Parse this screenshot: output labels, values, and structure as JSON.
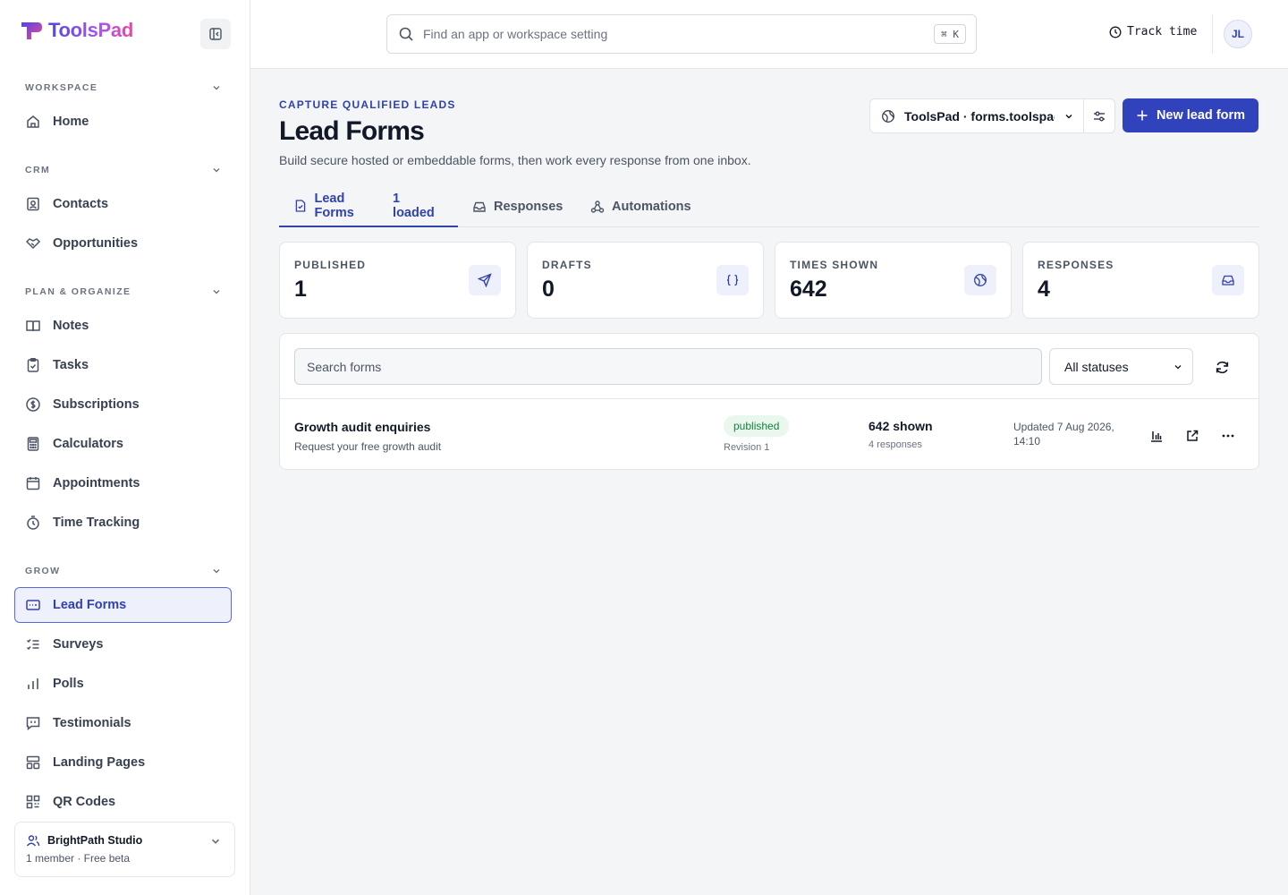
{
  "app": {
    "name": "ToolsPad"
  },
  "sidebar": {
    "sections": [
      {
        "label": "WORKSPACE"
      },
      {
        "label": "CRM"
      },
      {
        "label": "PLAN & ORGANIZE"
      },
      {
        "label": "GROW"
      }
    ],
    "items": [
      {
        "label": "Home",
        "icon": "home-icon"
      },
      {
        "label": "Contacts",
        "icon": "contact-icon"
      },
      {
        "label": "Opportunities",
        "icon": "handshake-icon"
      },
      {
        "label": "Notes",
        "icon": "notebook-icon"
      },
      {
        "label": "Tasks",
        "icon": "clipboard-check-icon"
      },
      {
        "label": "Subscriptions",
        "icon": "dollar-circle-icon"
      },
      {
        "label": "Calculators",
        "icon": "calculator-icon"
      },
      {
        "label": "Appointments",
        "icon": "calendar-icon"
      },
      {
        "label": "Time Tracking",
        "icon": "stopwatch-icon"
      },
      {
        "label": "Lead Forms",
        "icon": "form-icon",
        "active": true
      },
      {
        "label": "Surveys",
        "icon": "list-check-icon"
      },
      {
        "label": "Polls",
        "icon": "bar-chart-icon"
      },
      {
        "label": "Testimonials",
        "icon": "message-quote-icon"
      },
      {
        "label": "Landing Pages",
        "icon": "layout-icon"
      },
      {
        "label": "QR Codes",
        "icon": "qr-code-icon"
      }
    ],
    "workspace": {
      "name": "BrightPath Studio",
      "meta": "1 member · Free beta"
    }
  },
  "topbar": {
    "search_placeholder": "Find an app or workspace setting",
    "shortcut": "⌘ K",
    "track_time": "Track time",
    "avatar_initials": "JL"
  },
  "header": {
    "eyebrow": "CAPTURE QUALIFIED LEADS",
    "title": "Lead Forms",
    "subtitle": "Build secure hosted or embeddable forms, then work every response from one inbox.",
    "workspace_select": "ToolsPad · forms.toolspad",
    "new_button": "New lead form"
  },
  "tabs": [
    {
      "label": "Lead Forms",
      "count": "1 loaded",
      "active": true
    },
    {
      "label": "Responses"
    },
    {
      "label": "Automations"
    }
  ],
  "stats": [
    {
      "label": "PUBLISHED",
      "value": "1",
      "icon": "send-icon"
    },
    {
      "label": "DRAFTS",
      "value": "0",
      "icon": "braces-icon"
    },
    {
      "label": "TIMES SHOWN",
      "value": "642",
      "icon": "globe-icon"
    },
    {
      "label": "RESPONSES",
      "value": "4",
      "icon": "inbox-icon"
    }
  ],
  "forms_panel": {
    "search_placeholder": "Search forms",
    "status_filter": "All statuses",
    "rows": [
      {
        "title": "Growth audit enquiries",
        "subtitle": "Request your free growth audit",
        "status": "published",
        "revision": "Revision 1",
        "shown": "642 shown",
        "responses": "4 responses",
        "updated": "Updated 7 Aug 2026, 14:10"
      }
    ]
  },
  "colors": {
    "accent": "#3142bd",
    "active_bg": "#eef0fb",
    "published_bg": "#e9f7ee",
    "published_text": "#15803d"
  }
}
